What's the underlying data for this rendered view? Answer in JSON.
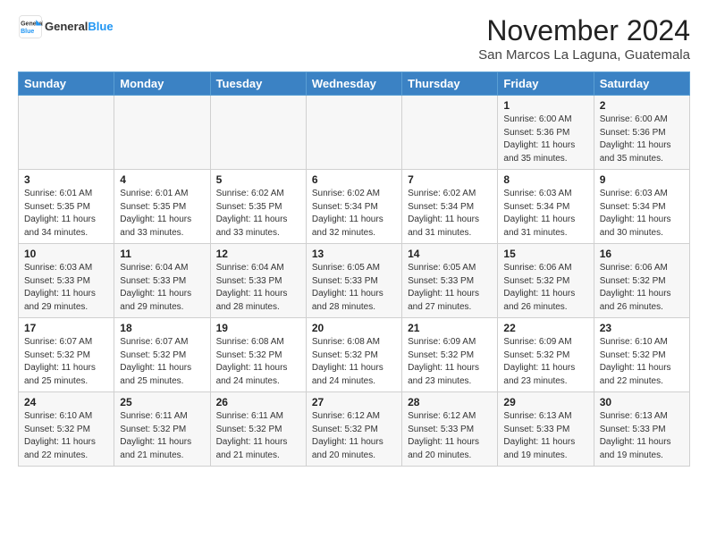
{
  "header": {
    "logo_line1": "General",
    "logo_line2": "Blue",
    "month": "November 2024",
    "location": "San Marcos La Laguna, Guatemala"
  },
  "days_of_week": [
    "Sunday",
    "Monday",
    "Tuesday",
    "Wednesday",
    "Thursday",
    "Friday",
    "Saturday"
  ],
  "weeks": [
    [
      {
        "day": "",
        "info": ""
      },
      {
        "day": "",
        "info": ""
      },
      {
        "day": "",
        "info": ""
      },
      {
        "day": "",
        "info": ""
      },
      {
        "day": "",
        "info": ""
      },
      {
        "day": "1",
        "info": "Sunrise: 6:00 AM\nSunset: 5:36 PM\nDaylight: 11 hours and 35 minutes."
      },
      {
        "day": "2",
        "info": "Sunrise: 6:00 AM\nSunset: 5:36 PM\nDaylight: 11 hours and 35 minutes."
      }
    ],
    [
      {
        "day": "3",
        "info": "Sunrise: 6:01 AM\nSunset: 5:35 PM\nDaylight: 11 hours and 34 minutes."
      },
      {
        "day": "4",
        "info": "Sunrise: 6:01 AM\nSunset: 5:35 PM\nDaylight: 11 hours and 33 minutes."
      },
      {
        "day": "5",
        "info": "Sunrise: 6:02 AM\nSunset: 5:35 PM\nDaylight: 11 hours and 33 minutes."
      },
      {
        "day": "6",
        "info": "Sunrise: 6:02 AM\nSunset: 5:34 PM\nDaylight: 11 hours and 32 minutes."
      },
      {
        "day": "7",
        "info": "Sunrise: 6:02 AM\nSunset: 5:34 PM\nDaylight: 11 hours and 31 minutes."
      },
      {
        "day": "8",
        "info": "Sunrise: 6:03 AM\nSunset: 5:34 PM\nDaylight: 11 hours and 31 minutes."
      },
      {
        "day": "9",
        "info": "Sunrise: 6:03 AM\nSunset: 5:34 PM\nDaylight: 11 hours and 30 minutes."
      }
    ],
    [
      {
        "day": "10",
        "info": "Sunrise: 6:03 AM\nSunset: 5:33 PM\nDaylight: 11 hours and 29 minutes."
      },
      {
        "day": "11",
        "info": "Sunrise: 6:04 AM\nSunset: 5:33 PM\nDaylight: 11 hours and 29 minutes."
      },
      {
        "day": "12",
        "info": "Sunrise: 6:04 AM\nSunset: 5:33 PM\nDaylight: 11 hours and 28 minutes."
      },
      {
        "day": "13",
        "info": "Sunrise: 6:05 AM\nSunset: 5:33 PM\nDaylight: 11 hours and 28 minutes."
      },
      {
        "day": "14",
        "info": "Sunrise: 6:05 AM\nSunset: 5:33 PM\nDaylight: 11 hours and 27 minutes."
      },
      {
        "day": "15",
        "info": "Sunrise: 6:06 AM\nSunset: 5:32 PM\nDaylight: 11 hours and 26 minutes."
      },
      {
        "day": "16",
        "info": "Sunrise: 6:06 AM\nSunset: 5:32 PM\nDaylight: 11 hours and 26 minutes."
      }
    ],
    [
      {
        "day": "17",
        "info": "Sunrise: 6:07 AM\nSunset: 5:32 PM\nDaylight: 11 hours and 25 minutes."
      },
      {
        "day": "18",
        "info": "Sunrise: 6:07 AM\nSunset: 5:32 PM\nDaylight: 11 hours and 25 minutes."
      },
      {
        "day": "19",
        "info": "Sunrise: 6:08 AM\nSunset: 5:32 PM\nDaylight: 11 hours and 24 minutes."
      },
      {
        "day": "20",
        "info": "Sunrise: 6:08 AM\nSunset: 5:32 PM\nDaylight: 11 hours and 24 minutes."
      },
      {
        "day": "21",
        "info": "Sunrise: 6:09 AM\nSunset: 5:32 PM\nDaylight: 11 hours and 23 minutes."
      },
      {
        "day": "22",
        "info": "Sunrise: 6:09 AM\nSunset: 5:32 PM\nDaylight: 11 hours and 23 minutes."
      },
      {
        "day": "23",
        "info": "Sunrise: 6:10 AM\nSunset: 5:32 PM\nDaylight: 11 hours and 22 minutes."
      }
    ],
    [
      {
        "day": "24",
        "info": "Sunrise: 6:10 AM\nSunset: 5:32 PM\nDaylight: 11 hours and 22 minutes."
      },
      {
        "day": "25",
        "info": "Sunrise: 6:11 AM\nSunset: 5:32 PM\nDaylight: 11 hours and 21 minutes."
      },
      {
        "day": "26",
        "info": "Sunrise: 6:11 AM\nSunset: 5:32 PM\nDaylight: 11 hours and 21 minutes."
      },
      {
        "day": "27",
        "info": "Sunrise: 6:12 AM\nSunset: 5:32 PM\nDaylight: 11 hours and 20 minutes."
      },
      {
        "day": "28",
        "info": "Sunrise: 6:12 AM\nSunset: 5:33 PM\nDaylight: 11 hours and 20 minutes."
      },
      {
        "day": "29",
        "info": "Sunrise: 6:13 AM\nSunset: 5:33 PM\nDaylight: 11 hours and 19 minutes."
      },
      {
        "day": "30",
        "info": "Sunrise: 6:13 AM\nSunset: 5:33 PM\nDaylight: 11 hours and 19 minutes."
      }
    ]
  ]
}
